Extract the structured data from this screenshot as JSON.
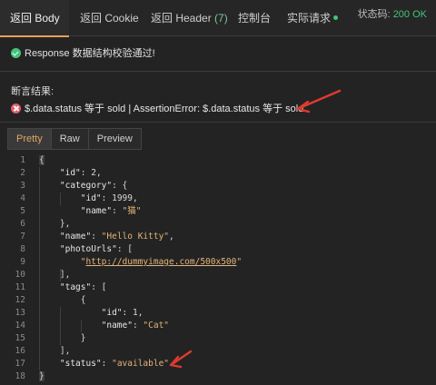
{
  "tabs": [
    {
      "label": "返回 Body",
      "active": true
    },
    {
      "label": "返回 Cookie"
    },
    {
      "label": "返回 Header",
      "count": "(7)"
    },
    {
      "label": "控制台"
    },
    {
      "label": "实际请求"
    }
  ],
  "status": {
    "label": "状态码:",
    "code": "200 OK"
  },
  "response_check": "Response 数据结构校验通过!",
  "assertion": {
    "title": "断言结果:",
    "message": "$.data.status 等于 sold | AssertionError: $.data.status 等于 sold"
  },
  "view_buttons": [
    "Pretty",
    "Raw",
    "Preview"
  ],
  "code_lines": [
    {
      "n": "1",
      "t": [
        [
          "p",
          "{"
        ]
      ]
    },
    {
      "n": "2",
      "t": [
        [
          "p",
          "    "
        ],
        [
          "k",
          "\"id\""
        ],
        [
          "p",
          ": "
        ],
        [
          "n",
          "2"
        ],
        [
          "p",
          ","
        ]
      ]
    },
    {
      "n": "3",
      "t": [
        [
          "p",
          "    "
        ],
        [
          "k",
          "\"category\""
        ],
        [
          "p",
          ": {"
        ]
      ]
    },
    {
      "n": "4",
      "t": [
        [
          "p",
          "        "
        ],
        [
          "k",
          "\"id\""
        ],
        [
          "p",
          ": "
        ],
        [
          "n",
          "1999"
        ],
        [
          "p",
          ","
        ]
      ]
    },
    {
      "n": "5",
      "t": [
        [
          "p",
          "        "
        ],
        [
          "k",
          "\"name\""
        ],
        [
          "p",
          ": "
        ],
        [
          "s",
          "\"猫\""
        ]
      ]
    },
    {
      "n": "6",
      "t": [
        [
          "p",
          "    },"
        ]
      ]
    },
    {
      "n": "7",
      "t": [
        [
          "p",
          "    "
        ],
        [
          "k",
          "\"name\""
        ],
        [
          "p",
          ": "
        ],
        [
          "s",
          "\"Hello Kitty\""
        ],
        [
          "p",
          ","
        ]
      ]
    },
    {
      "n": "8",
      "t": [
        [
          "p",
          "    "
        ],
        [
          "k",
          "\"photoUrls\""
        ],
        [
          "p",
          ": ["
        ]
      ]
    },
    {
      "n": "9",
      "t": [
        [
          "p",
          "        "
        ],
        [
          "s",
          "\""
        ],
        [
          "u",
          "http://dummyimage.com/500x500"
        ],
        [
          "s",
          "\""
        ]
      ]
    },
    {
      "n": "10",
      "t": [
        [
          "p",
          "    ],"
        ]
      ]
    },
    {
      "n": "11",
      "t": [
        [
          "p",
          "    "
        ],
        [
          "k",
          "\"tags\""
        ],
        [
          "p",
          ": ["
        ]
      ]
    },
    {
      "n": "12",
      "t": [
        [
          "p",
          "        {"
        ]
      ]
    },
    {
      "n": "13",
      "t": [
        [
          "p",
          "            "
        ],
        [
          "k",
          "\"id\""
        ],
        [
          "p",
          ": "
        ],
        [
          "n",
          "1"
        ],
        [
          "p",
          ","
        ]
      ]
    },
    {
      "n": "14",
      "t": [
        [
          "p",
          "            "
        ],
        [
          "k",
          "\"name\""
        ],
        [
          "p",
          ": "
        ],
        [
          "s",
          "\"Cat\""
        ]
      ]
    },
    {
      "n": "15",
      "t": [
        [
          "p",
          "        }"
        ]
      ]
    },
    {
      "n": "16",
      "t": [
        [
          "p",
          "    ],"
        ]
      ]
    },
    {
      "n": "17",
      "t": [
        [
          "p",
          "    "
        ],
        [
          "k",
          "\"status\""
        ],
        [
          "p",
          ": "
        ],
        [
          "s",
          "\"available\""
        ]
      ]
    },
    {
      "n": "18",
      "t": [
        [
          "p",
          "}"
        ]
      ]
    }
  ],
  "colors": {
    "accent": "#e0a15a",
    "ok": "#46c37b",
    "error": "#e55d6c",
    "annotation_arrow": "#e03a2f"
  }
}
